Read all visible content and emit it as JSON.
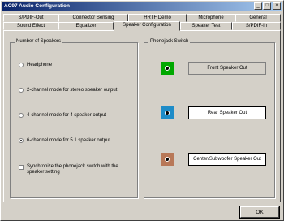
{
  "window": {
    "title": "AC97 Audio Configuration"
  },
  "titlebar_buttons": [
    {
      "glyph": "_",
      "name": "minimize"
    },
    {
      "glyph": "□",
      "name": "maximize"
    },
    {
      "glyph": "×",
      "name": "close"
    }
  ],
  "tabs": {
    "row1": [
      "S/PDIF-Out",
      "Connector Sensing",
      "HRTF Demo",
      "Microphone",
      "General"
    ],
    "row2": [
      "Sound Effect",
      "Equalizer",
      "Speaker Configuration",
      "Speaker Test",
      "S/PDIF-In"
    ],
    "active": "Speaker Configuration"
  },
  "speakers": {
    "group_title": "Number of Speakers",
    "options": [
      {
        "label": "Headphone",
        "checked": false
      },
      {
        "label": "2-channel mode for stereo speaker output",
        "checked": false
      },
      {
        "label": "4-channel mode for 4 speaker output",
        "checked": false
      },
      {
        "label": "6-channel mode for 5.1 speaker output",
        "checked": true
      }
    ],
    "sync_checkbox": {
      "line1": "Synchronize the phonejack switch with the",
      "line2": "speaker setting",
      "checked": false
    }
  },
  "phonejack": {
    "group_title": "Phonejack Switch",
    "jacks": [
      {
        "label": "Front Speaker Out",
        "color": "#00a800",
        "selected": false
      },
      {
        "label": "Rear Speaker Out",
        "color": "#1e8cc8",
        "selected": true
      },
      {
        "label": "Center/Subwoofer Speaker Out",
        "color": "#b87858",
        "selected": true
      }
    ]
  },
  "buttons": {
    "ok": "OK"
  }
}
